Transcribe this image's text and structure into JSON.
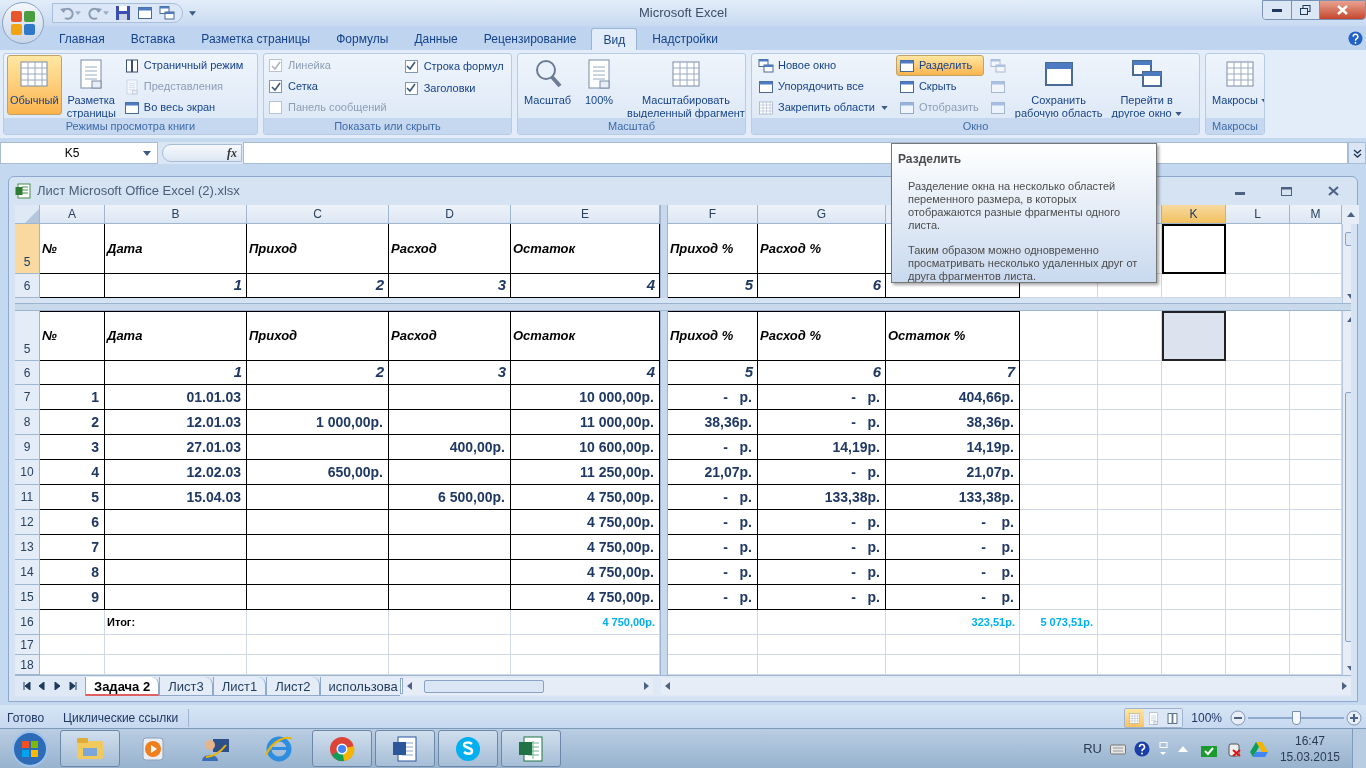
{
  "window": {
    "title": "Microsoft Excel"
  },
  "ribbon_tabs": [
    {
      "label": "Главная",
      "selected": false
    },
    {
      "label": "Вставка",
      "selected": false
    },
    {
      "label": "Разметка страницы",
      "selected": false
    },
    {
      "label": "Формулы",
      "selected": false
    },
    {
      "label": "Данные",
      "selected": false
    },
    {
      "label": "Рецензирование",
      "selected": false
    },
    {
      "label": "Вид",
      "selected": true
    },
    {
      "label": "Надстройки",
      "selected": false
    }
  ],
  "ribbon_groups": [
    {
      "label": "Режимы просмотра книги",
      "columns": [
        [
          {
            "kind": "large",
            "label": "Обычный",
            "selected": true,
            "disabled": false
          }
        ],
        [
          {
            "kind": "large",
            "label": "Разметка\nстраницы",
            "selected": false,
            "disabled": false
          }
        ],
        [
          {
            "kind": "small",
            "label": "Страничный режим",
            "selected": false,
            "disabled": false
          },
          {
            "kind": "small",
            "label": "Представления",
            "selected": false,
            "disabled": true
          },
          {
            "kind": "small",
            "label": "Во весь экран",
            "selected": false,
            "disabled": false
          }
        ]
      ]
    },
    {
      "label": "Показать или скрыть",
      "columns": [
        [
          {
            "kind": "checkbox",
            "label": "Линейка",
            "checked": true,
            "disabled": true
          },
          {
            "kind": "checkbox",
            "label": "Сетка",
            "checked": true,
            "disabled": false
          },
          {
            "kind": "checkbox",
            "label": "Панель сообщений",
            "checked": false,
            "disabled": true
          }
        ],
        [
          {
            "kind": "checkbox",
            "label": "Строка формул",
            "checked": true,
            "disabled": false
          },
          {
            "kind": "checkbox",
            "label": "Заголовки",
            "checked": true,
            "disabled": false
          }
        ]
      ]
    },
    {
      "label": "Масштаб",
      "columns": [
        [
          {
            "kind": "large",
            "label": "Масштаб",
            "selected": false,
            "disabled": false
          }
        ],
        [
          {
            "kind": "large",
            "label": "100%",
            "selected": false,
            "disabled": false
          }
        ],
        [
          {
            "kind": "large",
            "label": "Масштабировать\nвыделенный фрагмент",
            "selected": false,
            "disabled": false
          }
        ]
      ]
    },
    {
      "label": "Окно",
      "columns": [
        [
          {
            "kind": "small",
            "label": "Новое окно",
            "selected": false,
            "disabled": false
          },
          {
            "kind": "small",
            "label": "Упорядочить все",
            "selected": false,
            "disabled": false
          },
          {
            "kind": "small",
            "label": "Закрепить области",
            "selected": false,
            "disabled": false,
            "dropdown": true
          }
        ],
        [
          {
            "kind": "small",
            "label": "Разделить",
            "selected": true,
            "disabled": false
          },
          {
            "kind": "small",
            "label": "Скрыть",
            "selected": false,
            "disabled": false
          },
          {
            "kind": "small",
            "label": "Отобразить",
            "selected": false,
            "disabled": true
          }
        ],
        [
          {
            "kind": "icon",
            "selected": false,
            "disabled": true
          },
          {
            "kind": "icon",
            "selected": false,
            "disabled": true
          },
          {
            "kind": "icon",
            "selected": false,
            "disabled": true
          }
        ],
        [
          {
            "kind": "large",
            "label": "Сохранить\nрабочую область",
            "selected": false,
            "disabled": false
          }
        ],
        [
          {
            "kind": "large",
            "label": "Перейти в\nдругое окно",
            "selected": false,
            "disabled": false,
            "dropdown": true
          }
        ]
      ]
    },
    {
      "label": "Макросы",
      "columns": [
        [
          {
            "kind": "large",
            "label": "Макросы",
            "selected": false,
            "disabled": false,
            "dropdown": true
          }
        ]
      ]
    }
  ],
  "formula_bar": {
    "name_box": "K5",
    "function_button": "fx"
  },
  "tooltip": {
    "title": "Разделить",
    "paragraphs": [
      "Разделение окна на несколько областей переменного размера, в которых отображаются разные фрагменты одного листа.",
      "Таким образом можно одновременно просматривать несколько удаленных друг от друга фрагментов листа."
    ]
  },
  "workbook": {
    "title": "Лист Microsoft Office Excel (2).xlsx",
    "column_headers": [
      {
        "label": "A",
        "selected": false
      },
      {
        "label": "B",
        "selected": false
      },
      {
        "label": "C",
        "selected": false
      },
      {
        "label": "D",
        "selected": false
      },
      {
        "label": "E",
        "selected": false
      },
      {
        "label": "F",
        "selected": false
      },
      {
        "label": "G",
        "selected": false
      }
    ],
    "column_headers_after_tooltip": [
      {
        "label": "K",
        "selected": true
      },
      {
        "label": "L",
        "selected": false
      },
      {
        "label": "M",
        "selected": false
      }
    ],
    "panes": [
      {
        "active": true,
        "rows": [
          {
            "row": "5",
            "kind": "header",
            "selected": true,
            "has_selection": true,
            "cells": {
              "A": "№",
              "B": "Дата",
              "C": "Приход",
              "D": "Расход",
              "E": "Остаток",
              "F": "Приход %",
              "G": "Расход %"
            }
          },
          {
            "row": "6",
            "kind": "index",
            "selected": false,
            "cells": {
              "B": "1",
              "C": "2",
              "D": "3",
              "E": "4",
              "F": "5",
              "G": "6"
            }
          }
        ]
      },
      {
        "active": false,
        "rows": [
          {
            "row": "5",
            "kind": "header",
            "selected": false,
            "has_selection": true,
            "cells": {
              "A": "№",
              "B": "Дата",
              "C": "Приход",
              "D": "Расход",
              "E": "Остаток",
              "F": "Приход %",
              "G": "Расход %",
              "H": "Остаток %"
            }
          },
          {
            "row": "6",
            "kind": "index",
            "selected": false,
            "cells": {
              "B": "1",
              "C": "2",
              "D": "3",
              "E": "4",
              "F": "5",
              "G": "6",
              "H": "7"
            }
          },
          {
            "row": "7",
            "kind": "data",
            "selected": false,
            "cells": {
              "A": "1",
              "B": "01.01.03",
              "E": "10 000,00р.",
              "F": "-   р.",
              "G": "-   р.",
              "H": "404,66р."
            }
          },
          {
            "row": "8",
            "kind": "data",
            "selected": false,
            "cells": {
              "A": "2",
              "B": "12.01.03",
              "C": "1 000,00р.",
              "E": "11 000,00р.",
              "F": "38,36р.",
              "G": "-   р.",
              "H": "38,36р."
            }
          },
          {
            "row": "9",
            "kind": "data",
            "selected": false,
            "cells": {
              "A": "3",
              "B": "27.01.03",
              "D": "400,00р.",
              "E": "10 600,00р.",
              "F": "-   р.",
              "G": "14,19р.",
              "H": "14,19р."
            }
          },
          {
            "row": "10",
            "kind": "data",
            "selected": false,
            "cells": {
              "A": "4",
              "B": "12.02.03",
              "C": "650,00р.",
              "E": "11 250,00р.",
              "F": "21,07р.",
              "G": "-   р.",
              "H": "21,07р."
            }
          },
          {
            "row": "11",
            "kind": "data",
            "selected": false,
            "cells": {
              "A": "5",
              "B": "15.04.03",
              "D": "6 500,00р.",
              "E": "4 750,00р.",
              "F": "-   р.",
              "G": "133,38р.",
              "H": "133,38р."
            }
          },
          {
            "row": "12",
            "kind": "data",
            "selected": false,
            "cells": {
              "A": "6",
              "E": "4 750,00р.",
              "F": "-   р.",
              "G": "-   р.",
              "H": "-    р."
            }
          },
          {
            "row": "13",
            "kind": "data",
            "selected": false,
            "cells": {
              "A": "7",
              "E": "4 750,00р.",
              "F": "-   р.",
              "G": "-   р.",
              "H": "-    р."
            }
          },
          {
            "row": "14",
            "kind": "data",
            "selected": false,
            "cells": {
              "A": "8",
              "E": "4 750,00р.",
              "F": "-   р.",
              "G": "-   р.",
              "H": "-    р."
            }
          },
          {
            "row": "15",
            "kind": "data",
            "selected": false,
            "cells": {
              "A": "9",
              "E": "4 750,00р.",
              "F": "-   р.",
              "G": "-   р.",
              "H": "-    р."
            }
          },
          {
            "row": "16",
            "kind": "total",
            "selected": false,
            "cells": {
              "B": "Итог:",
              "E": "4 750,00р.",
              "H": "323,51р.",
              "I": "5 073,51р."
            }
          },
          {
            "row": "17",
            "kind": "blank",
            "selected": false
          },
          {
            "row": "18",
            "kind": "blank",
            "selected": false
          }
        ]
      }
    ]
  },
  "sheet_tabs": [
    {
      "label": "Задача 2",
      "selected": true
    },
    {
      "label": "Лист3",
      "selected": false
    },
    {
      "label": "Лист1",
      "selected": false
    },
    {
      "label": "Лист2",
      "selected": false
    },
    {
      "label": "использова",
      "selected": false
    }
  ],
  "status_bar": {
    "items": [
      "Готово",
      "Циклические ссылки"
    ],
    "view_buttons": [
      {
        "selected": true
      },
      {
        "selected": false
      },
      {
        "selected": false
      }
    ],
    "zoom": "100%",
    "zoom_slider": {
      "level": 0.5
    }
  },
  "taskbar": {
    "apps": [
      {
        "running": true
      },
      {
        "running": false
      },
      {
        "running": false
      },
      {
        "running": false
      },
      {
        "running": true
      },
      {
        "running": true
      },
      {
        "running": true
      },
      {
        "running": true
      }
    ],
    "language": "RU",
    "time": "16:47",
    "date": "15.03.2015"
  }
}
